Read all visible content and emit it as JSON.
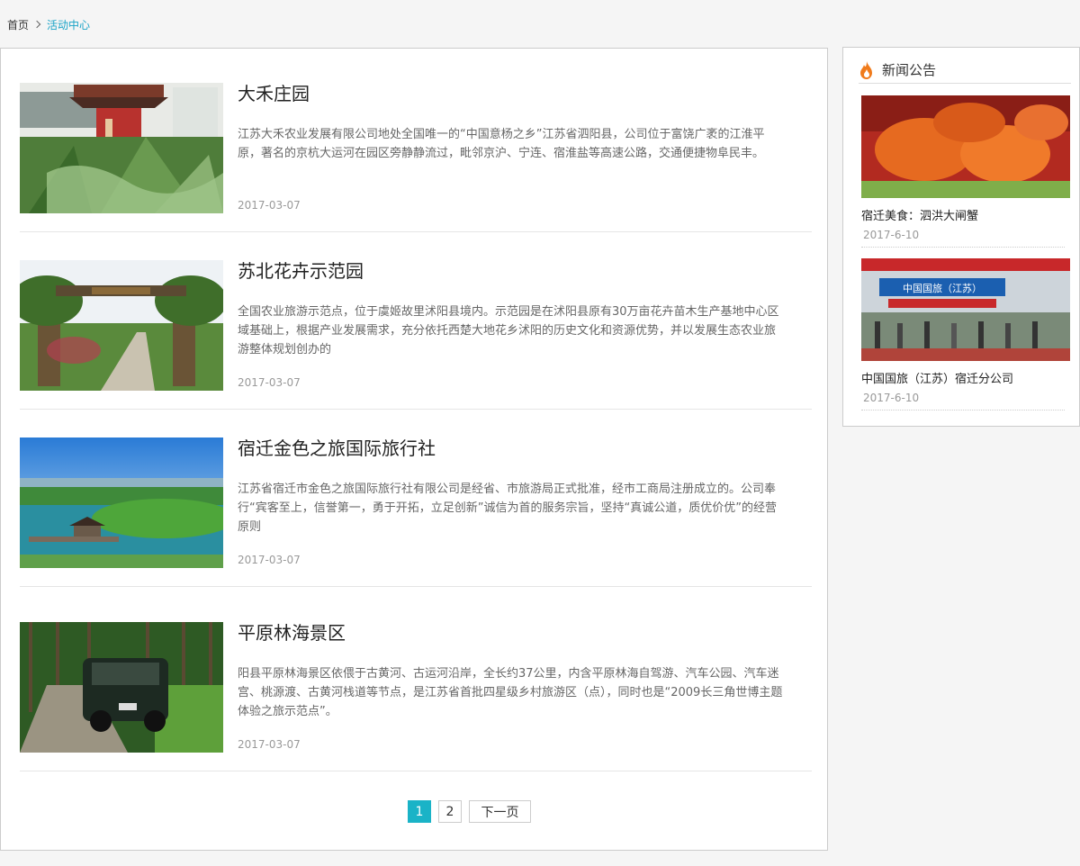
{
  "breadcrumb": {
    "home": "首页",
    "current": "活动中心"
  },
  "articles": [
    {
      "title": "大禾庄园",
      "desc": "江苏大禾农业发展有限公司地处全国唯一的“中国意杨之乡”江苏省泗阳县，公司位于富饶广袤的江淮平原，著名的京杭大运河在园区旁静静流过，毗邻京沪、宁连、宿淮盐等高速公路，交通便捷物阜民丰。",
      "date": "2017-03-07"
    },
    {
      "title": "苏北花卉示范园",
      "desc": "全国农业旅游示范点，位于虞姬故里沭阳县境内。示范园是在沭阳县原有30万亩花卉苗木生产基地中心区域基础上，根据产业发展需求，充分依托西楚大地花乡沭阳的历史文化和资源优势，并以发展生态农业旅游整体规划创办的",
      "date": "2017-03-07"
    },
    {
      "title": "宿迁金色之旅国际旅行社",
      "desc": "江苏省宿迁市金色之旅国际旅行社有限公司是经省、市旅游局正式批准，经市工商局注册成立的。公司奉行“宾客至上，信誉第一，勇于开拓，立足创新”诚信为首的服务宗旨，坚持“真诚公道，质优价优”的经营原则",
      "date": "2017-03-07"
    },
    {
      "title": "平原林海景区",
      "desc": "阳县平原林海景区依偎于古黄河、古运河沿岸，全长约37公里，内含平原林海自驾游、汽车公园、汽车迷宫、桃源渡、古黄河栈道等节点，是江苏省首批四星级乡村旅游区（点），同时也是“2009长三角世博主题体验之旅示范点”。",
      "date": "2017-03-07"
    }
  ],
  "pagination": {
    "pages": [
      "1",
      "2"
    ],
    "next": "下一页"
  },
  "sidebar": {
    "title": "新闻公告",
    "items": [
      {
        "title": "宿迁美食：泗洪大闸蟹",
        "date": "2017-6-10"
      },
      {
        "title": "中国国旅（江苏）宿迁分公司",
        "date": "2017-6-10",
        "sign_text": "中国国旅（江苏）"
      }
    ]
  }
}
